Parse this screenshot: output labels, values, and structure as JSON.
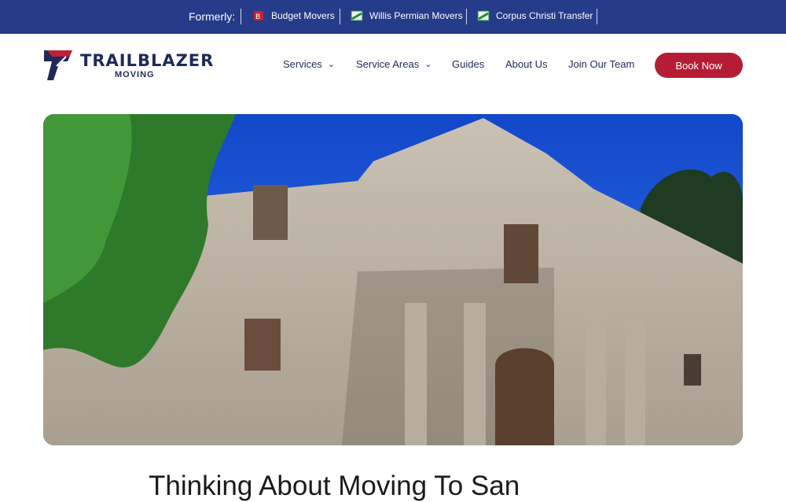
{
  "topbar": {
    "formerly_label": "Formerly:",
    "brands": [
      {
        "name": "Budget Movers",
        "icon": "budget-movers-logo-icon"
      },
      {
        "name": "Willis Permian Movers",
        "icon": "willis-permian-logo-icon"
      },
      {
        "name": "Corpus Christi Transfer",
        "icon": "corpus-christi-logo-icon"
      }
    ],
    "colors": {
      "bar": "#263b8a"
    }
  },
  "header": {
    "logo_word": "TRAILBLAZER",
    "logo_sub": "MOVING",
    "nav": [
      {
        "label": "Services",
        "has_dropdown": true
      },
      {
        "label": "Service Areas",
        "has_dropdown": true
      },
      {
        "label": "Guides",
        "has_dropdown": false
      },
      {
        "label": "About Us",
        "has_dropdown": false
      },
      {
        "label": "Join Our Team",
        "has_dropdown": false
      }
    ],
    "cta": "Book Now",
    "colors": {
      "cta": "#b51d34",
      "text": "#1f2a5a"
    }
  },
  "hero": {
    "image": "alamo-mission-photo"
  },
  "content": {
    "title": "Thinking About Moving To San"
  }
}
